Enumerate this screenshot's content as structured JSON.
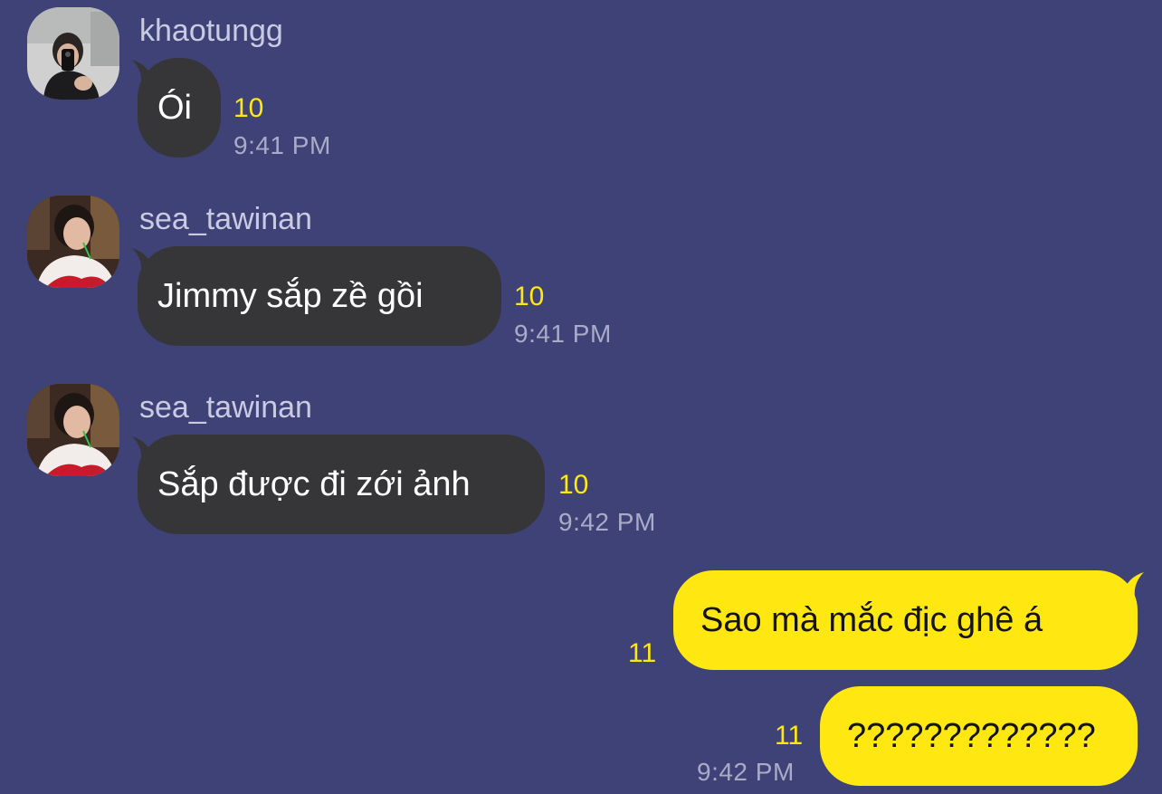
{
  "messages": [
    {
      "direction": "incoming",
      "sender": "khaotungg",
      "text": "Ói",
      "count": "10",
      "time": "9:41 PM"
    },
    {
      "direction": "incoming",
      "sender": "sea_tawinan",
      "text": "Jimmy sắp zề gồi",
      "count": "10",
      "time": "9:41 PM"
    },
    {
      "direction": "incoming",
      "sender": "sea_tawinan",
      "text": "Sắp được đi zới ảnh",
      "count": "10",
      "time": "9:42 PM"
    },
    {
      "direction": "outgoing",
      "text": "Sao mà mắc địc ghê á",
      "count": "11"
    },
    {
      "direction": "outgoing",
      "text": "?????????????",
      "count": "11",
      "time": "9:42 PM"
    }
  ],
  "colors": {
    "background": "#3f4277",
    "incoming_bubble": "#363537",
    "outgoing_bubble": "#ffe812",
    "unread_count": "#ffe812",
    "timestamp": "#a9abc8"
  },
  "icons": {
    "avatar_khaotungg": "profile-photo",
    "avatar_sea_tawinan": "profile-photo"
  }
}
